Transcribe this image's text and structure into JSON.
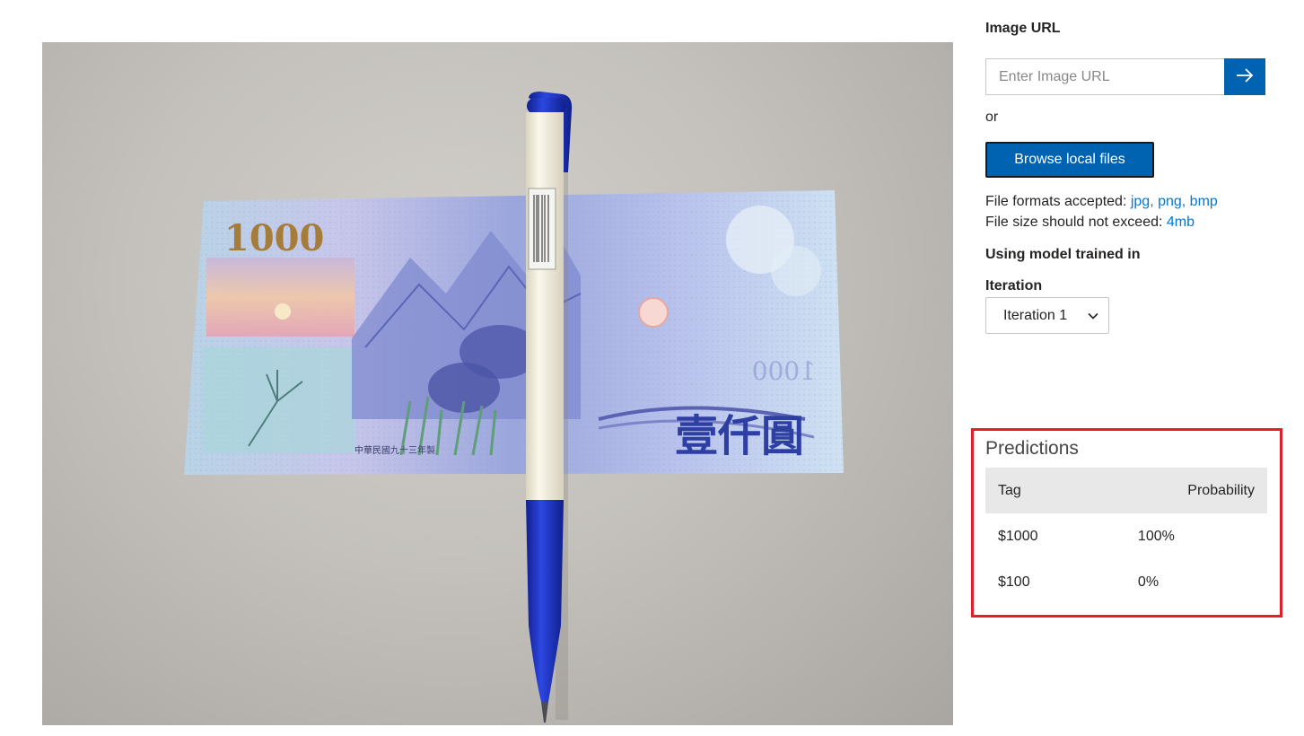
{
  "photo": {
    "banknote_numeral": "1000",
    "banknote_mirror_numeral": "1000",
    "banknote_chinese_value": "壹仟圓",
    "banknote_small_print": "中華民國九十三年製",
    "colors": {
      "background": "#c4c1bc",
      "note_blue": "#9aa6dc",
      "pen_blue": "#1d36c8",
      "pen_body": "#f3efdf"
    }
  },
  "image_url": {
    "label": "Image URL",
    "placeholder": "Enter Image URL",
    "value": ""
  },
  "or_text": "or",
  "browse_button": "Browse local files",
  "file_info": {
    "formats_prefix": "File formats accepted: ",
    "formats_value": "jpg, png, bmp",
    "size_prefix": "File size should not exceed: ",
    "size_value": "4mb"
  },
  "model_label": "Using model trained in",
  "iteration": {
    "label": "Iteration",
    "selected": "Iteration 1"
  },
  "predictions": {
    "title": "Predictions",
    "columns": {
      "tag": "Tag",
      "probability": "Probability"
    },
    "rows": [
      {
        "tag": "$1000",
        "probability": "100%"
      },
      {
        "tag": "$100",
        "probability": "0%"
      }
    ]
  },
  "colors": {
    "accent": "#0063b1",
    "link": "#0078d4",
    "highlight_border": "#e0202a"
  }
}
